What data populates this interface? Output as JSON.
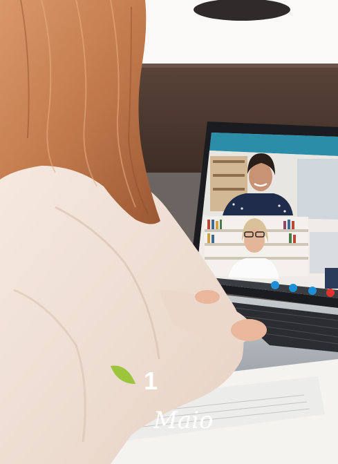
{
  "overlay": {
    "day": "1",
    "month": "Maio"
  },
  "colors": {
    "leaf": "#9cc43c",
    "text": "#ffffff",
    "screen_header": "#2b8da8",
    "hangup": "#e0332f",
    "call_button": "#1e8fd6"
  },
  "icons": {
    "leaf": "leaf-icon",
    "camera": "camera-icon",
    "mic": "mic-icon",
    "chat": "chat-icon",
    "hangup": "hangup-icon"
  }
}
